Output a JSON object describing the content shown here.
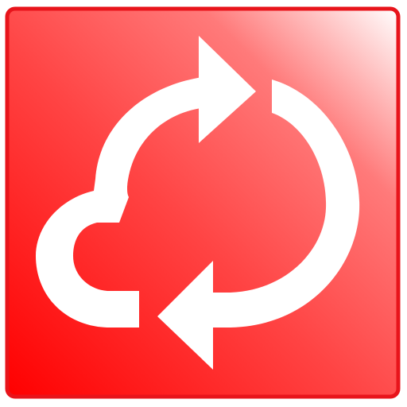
{
  "icon": {
    "name": "cloud-sync-icon",
    "colors": {
      "tile_dark": "#ff0000",
      "tile_mid": "#ff4444",
      "tile_light": "#ffffff",
      "border": "#e8141b",
      "glyph": "#ffffff"
    }
  }
}
